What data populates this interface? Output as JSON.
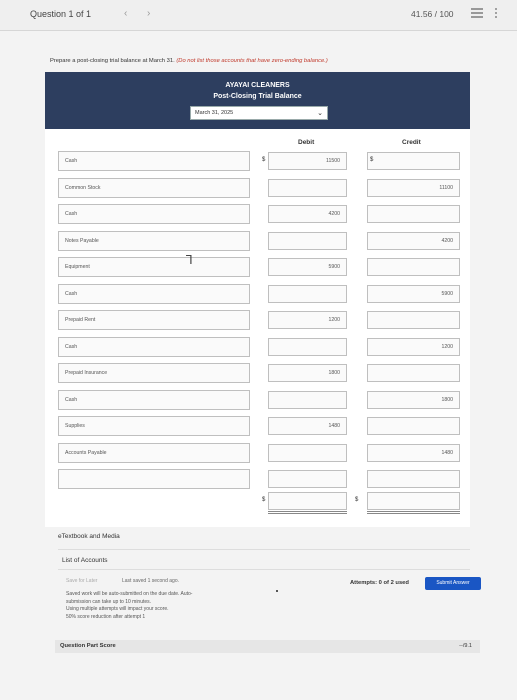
{
  "topbar": {
    "question_label": "Question 1 of 1",
    "prev": "‹",
    "next": "›",
    "score": "41.56 / 100"
  },
  "instruction": {
    "text": "Prepare a post-closing trial balance at March 31.",
    "note": "(Do not list those accounts that have zero-ending balance.)"
  },
  "header": {
    "company": "AYAYAI CLEANERS",
    "title": "Post-Closing Trial Balance",
    "date_value": "March 31, 2025"
  },
  "columns": {
    "debit": "Debit",
    "credit": "Credit"
  },
  "currency": "$",
  "rows": [
    {
      "account": "Cash",
      "debit": "11500",
      "credit": ""
    },
    {
      "account": "Common Stock",
      "debit": "",
      "credit": "11100"
    },
    {
      "account": "Cash",
      "debit": "4200",
      "credit": ""
    },
    {
      "account": "Notes Payable",
      "debit": "",
      "credit": "4200"
    },
    {
      "account": "Equipment",
      "debit": "5900",
      "credit": ""
    },
    {
      "account": "Cash",
      "debit": "",
      "credit": "5900"
    },
    {
      "account": "Prepaid Rent",
      "debit": "1200",
      "credit": ""
    },
    {
      "account": "Cash",
      "debit": "",
      "credit": "1200"
    },
    {
      "account": "Prepaid Insurance",
      "debit": "1800",
      "credit": ""
    },
    {
      "account": "Cash",
      "debit": "",
      "credit": "1800"
    },
    {
      "account": "Supplies",
      "debit": "1480",
      "credit": ""
    },
    {
      "account": "Accounts Payable",
      "debit": "",
      "credit": "1480"
    },
    {
      "account": "",
      "debit": "",
      "credit": ""
    }
  ],
  "links": {
    "etextbook": "eTextbook and Media",
    "list_accounts": "List of Accounts"
  },
  "footer": {
    "save_later": "Save for Later",
    "last_saved": "Last saved 1 second ago.",
    "autosave_1": "Saved work will be auto-submitted on the due date. Auto-",
    "autosave_2": "submission can take up to 10 minutes.",
    "autosave_3": "Using multiple attempts will impact your score.",
    "autosave_4": "50% score reduction after attempt 1",
    "attempts": "Attempts: 0 of 2 used",
    "submit": "Submit Answer",
    "qps_label": "Question Part Score",
    "qps_score": "--/9.1"
  },
  "colors": {
    "header_bg": "#2d3e5f",
    "submit_bg": "#1a56c4",
    "note_red": "#c0392b"
  }
}
